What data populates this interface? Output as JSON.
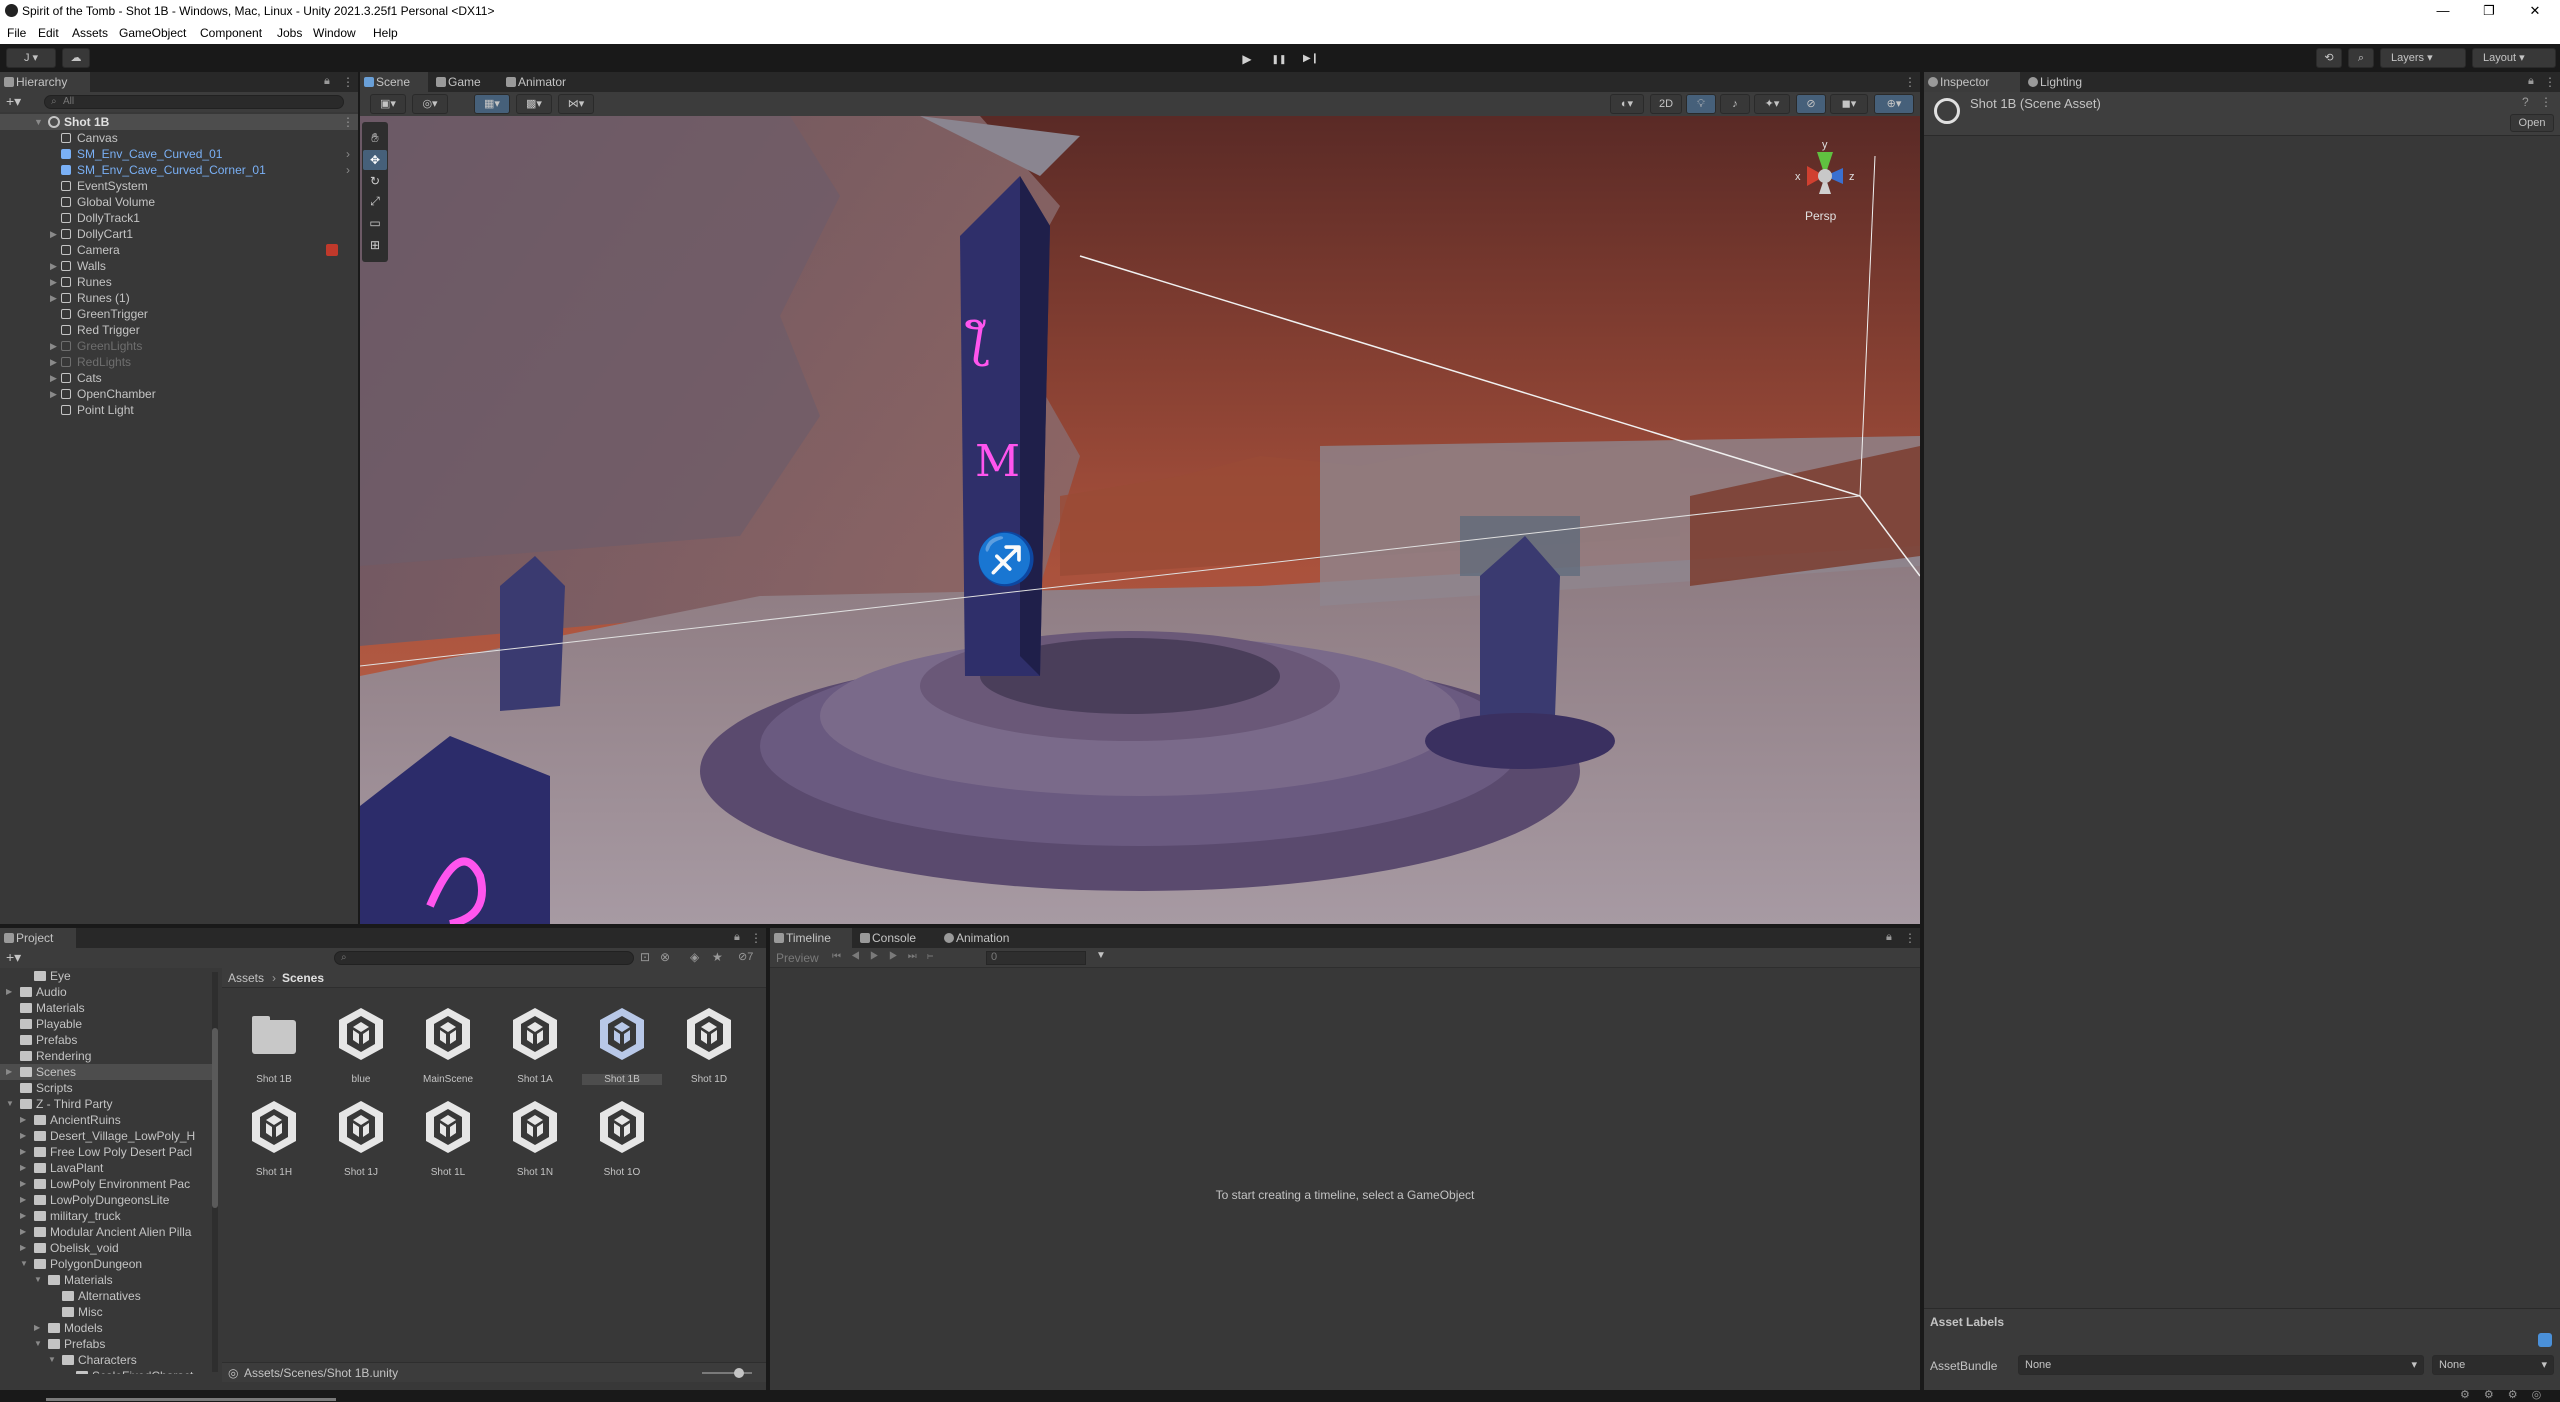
{
  "window": {
    "title": "Spirit of the Tomb - Shot 1B - Windows, Mac, Linux - Unity 2021.3.25f1 Personal <DX11>",
    "minimize": "—",
    "maximize": "❐",
    "close": "✕"
  },
  "menu": [
    "File",
    "Edit",
    "Assets",
    "GameObject",
    "Component",
    "Jobs",
    "Window",
    "Help"
  ],
  "toolbar": {
    "account": "J ▾",
    "cloud": "☁",
    "play": "▶",
    "pause": "❚❚",
    "step": "▶❙",
    "layers": "Layers",
    "layout": "Layout"
  },
  "hierarchy": {
    "tab": "Hierarchy",
    "search_placeholder": "All",
    "scene_name": "Shot 1B",
    "items": [
      {
        "label": "Canvas",
        "style": "normal",
        "arrow": ""
      },
      {
        "label": "SM_Env_Cave_Curved_01",
        "style": "prefab",
        "arrow": ""
      },
      {
        "label": "SM_Env_Cave_Curved_Corner_01",
        "style": "prefab",
        "arrow": ""
      },
      {
        "label": "EventSystem",
        "style": "normal",
        "arrow": ""
      },
      {
        "label": "Global Volume",
        "style": "normal",
        "arrow": ""
      },
      {
        "label": "DollyTrack1",
        "style": "normal",
        "arrow": ""
      },
      {
        "label": "DollyCart1",
        "style": "normal",
        "arrow": "▶"
      },
      {
        "label": "Camera",
        "style": "normal",
        "arrow": ""
      },
      {
        "label": "Walls",
        "style": "normal",
        "arrow": "▶"
      },
      {
        "label": "Runes",
        "style": "normal",
        "arrow": "▶"
      },
      {
        "label": "Runes (1)",
        "style": "normal",
        "arrow": "▶"
      },
      {
        "label": "GreenTrigger",
        "style": "normal",
        "arrow": ""
      },
      {
        "label": "Red Trigger",
        "style": "normal",
        "arrow": ""
      },
      {
        "label": "GreenLights",
        "style": "disabled",
        "arrow": "▶"
      },
      {
        "label": "RedLights",
        "style": "disabled",
        "arrow": "▶"
      },
      {
        "label": "Cats",
        "style": "normal",
        "arrow": "▶"
      },
      {
        "label": "OpenChamber",
        "style": "normal",
        "arrow": "▶"
      },
      {
        "label": "Point Light",
        "style": "normal",
        "arrow": ""
      }
    ]
  },
  "scene": {
    "tabs": [
      "Scene",
      "Game",
      "Animator"
    ],
    "mode_2d": "2D",
    "persp": "Persp",
    "gizmo_x": "x",
    "gizmo_y": "y",
    "gizmo_z": "z"
  },
  "inspector": {
    "tabs": [
      "Inspector",
      "Lighting"
    ],
    "asset_title": "Shot 1B (Scene Asset)",
    "open_button": "Open",
    "asset_labels": "Asset Labels",
    "assetbundle_label": "AssetBundle",
    "assetbundle_value": "None",
    "variant_value": "None"
  },
  "project": {
    "tab": "Project",
    "breadcrumb_root": "Assets",
    "breadcrumb_current": "Scenes",
    "hidden_count": "7",
    "tree": [
      {
        "label": "Eye",
        "indent": 1,
        "arrow": ""
      },
      {
        "label": "Audio",
        "indent": 0,
        "arrow": "▶"
      },
      {
        "label": "Materials",
        "indent": 0,
        "arrow": ""
      },
      {
        "label": "Playable",
        "indent": 0,
        "arrow": ""
      },
      {
        "label": "Prefabs",
        "indent": 0,
        "arrow": ""
      },
      {
        "label": "Rendering",
        "indent": 0,
        "arrow": ""
      },
      {
        "label": "Scenes",
        "indent": 0,
        "arrow": "▶"
      },
      {
        "label": "Scripts",
        "indent": 0,
        "arrow": ""
      },
      {
        "label": "Z - Third Party",
        "indent": 0,
        "arrow": "▼"
      },
      {
        "label": "AncientRuins",
        "indent": 1,
        "arrow": "▶"
      },
      {
        "label": "Desert_Village_LowPoly_H",
        "indent": 1,
        "arrow": "▶"
      },
      {
        "label": "Free Low Poly Desert Pacl",
        "indent": 1,
        "arrow": "▶"
      },
      {
        "label": "LavaPlant",
        "indent": 1,
        "arrow": "▶"
      },
      {
        "label": "LowPoly Environment Pac",
        "indent": 1,
        "arrow": "▶"
      },
      {
        "label": "LowPolyDungeonsLite",
        "indent": 1,
        "arrow": "▶"
      },
      {
        "label": "military_truck",
        "indent": 1,
        "arrow": "▶"
      },
      {
        "label": "Modular Ancient Alien Pilla",
        "indent": 1,
        "arrow": "▶"
      },
      {
        "label": "Obelisk_void",
        "indent": 1,
        "arrow": "▶"
      },
      {
        "label": "PolygonDungeon",
        "indent": 1,
        "arrow": "▼"
      },
      {
        "label": "Materials",
        "indent": 2,
        "arrow": "▼"
      },
      {
        "label": "Alternatives",
        "indent": 3,
        "arrow": ""
      },
      {
        "label": "Misc",
        "indent": 3,
        "arrow": ""
      },
      {
        "label": "Models",
        "indent": 2,
        "arrow": "▶"
      },
      {
        "label": "Prefabs",
        "indent": 2,
        "arrow": "▼"
      },
      {
        "label": "Characters",
        "indent": 3,
        "arrow": "▼"
      },
      {
        "label": "ScaleFixedCharact",
        "indent": 4,
        "arrow": ""
      }
    ],
    "assets": [
      {
        "label": "Shot 1B",
        "kind": "folder"
      },
      {
        "label": "blue",
        "kind": "scene"
      },
      {
        "label": "MainScene",
        "kind": "scene"
      },
      {
        "label": "Shot 1A",
        "kind": "scene"
      },
      {
        "label": "Shot 1B",
        "kind": "scene-selected"
      },
      {
        "label": "Shot 1D",
        "kind": "scene"
      },
      {
        "label": "Shot 1H",
        "kind": "scene"
      },
      {
        "label": "Shot 1J",
        "kind": "scene"
      },
      {
        "label": "Shot 1L",
        "kind": "scene"
      },
      {
        "label": "Shot 1N",
        "kind": "scene"
      },
      {
        "label": "Shot 1O",
        "kind": "scene"
      }
    ],
    "footer_path": "Assets/Scenes/Shot 1B.unity"
  },
  "timeline": {
    "tabs": [
      "Timeline",
      "Console",
      "Animation"
    ],
    "preview": "Preview",
    "frame": "0",
    "empty_message": "To start creating a timeline, select a GameObject"
  },
  "colors": {
    "panel": "#383838",
    "dark": "#191919",
    "prefab_text": "#7ab0f5",
    "selection": "#2c5d87",
    "accent_blue": "#4a90d9"
  }
}
